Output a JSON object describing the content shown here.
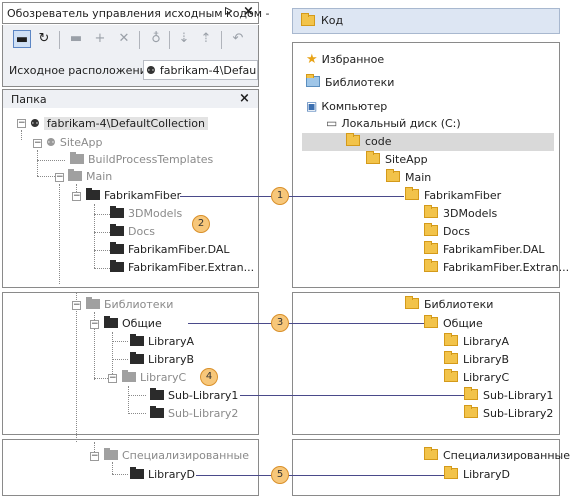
{
  "left_panel": {
    "title": "Обозреватель управления исходным кодом -",
    "pin_glyph": "ᐅ",
    "close_glyph": "×",
    "source_label": "Исходное расположение:",
    "source_value": "fabrikam-4\\Default...",
    "folder_header": "Папка",
    "folder_close": "×"
  },
  "left_tree": {
    "root": "fabrikam-4\\DefaultCollection",
    "siteapp": "SiteApp",
    "buildprocess": "BuildProcessTemplates",
    "main": "Main",
    "fabrikamfiber": "FabrikamFiber",
    "models3d": "3DModels",
    "docs": "Docs",
    "dal": "FabrikamFiber.DAL",
    "extran": "FabrikamFiber.Extran...",
    "libraries": "Библиотеки",
    "common": "Общие",
    "libA": "LibraryA",
    "libB": "LibraryB",
    "libC": "LibraryC",
    "sub1": "Sub-Library1",
    "sub2": "Sub-Library2",
    "special": "Специализированные",
    "libD": "LibraryD"
  },
  "right_panel": {
    "header": "Код",
    "favorites": "Избранное",
    "libraries": "Библиотеки",
    "computer": "Компьютер",
    "local_disk": "Локальный диск (C:)",
    "code": "code",
    "siteapp": "SiteApp",
    "main": "Main",
    "fabrikamfiber": "FabrikamFiber",
    "models3d": "3DModels",
    "docs": "Docs",
    "dal": "FabrikamFiber.DAL",
    "extran": "FabrikamFiber.Extran...",
    "libraries2": "Библиотеки",
    "common": "Общие",
    "libA": "LibraryA",
    "libB": "LibraryB",
    "libC": "LibraryC",
    "sub1": "Sub-Library1",
    "sub2": "Sub-Library2",
    "special": "Специализированные",
    "libD": "LibraryD"
  },
  "callouts": [
    "1",
    "2",
    "3",
    "4",
    "5"
  ],
  "colors": {
    "callout_fill": "#f7c77a",
    "line": "#4a4a8a",
    "header_blue": "#dde6f3"
  }
}
